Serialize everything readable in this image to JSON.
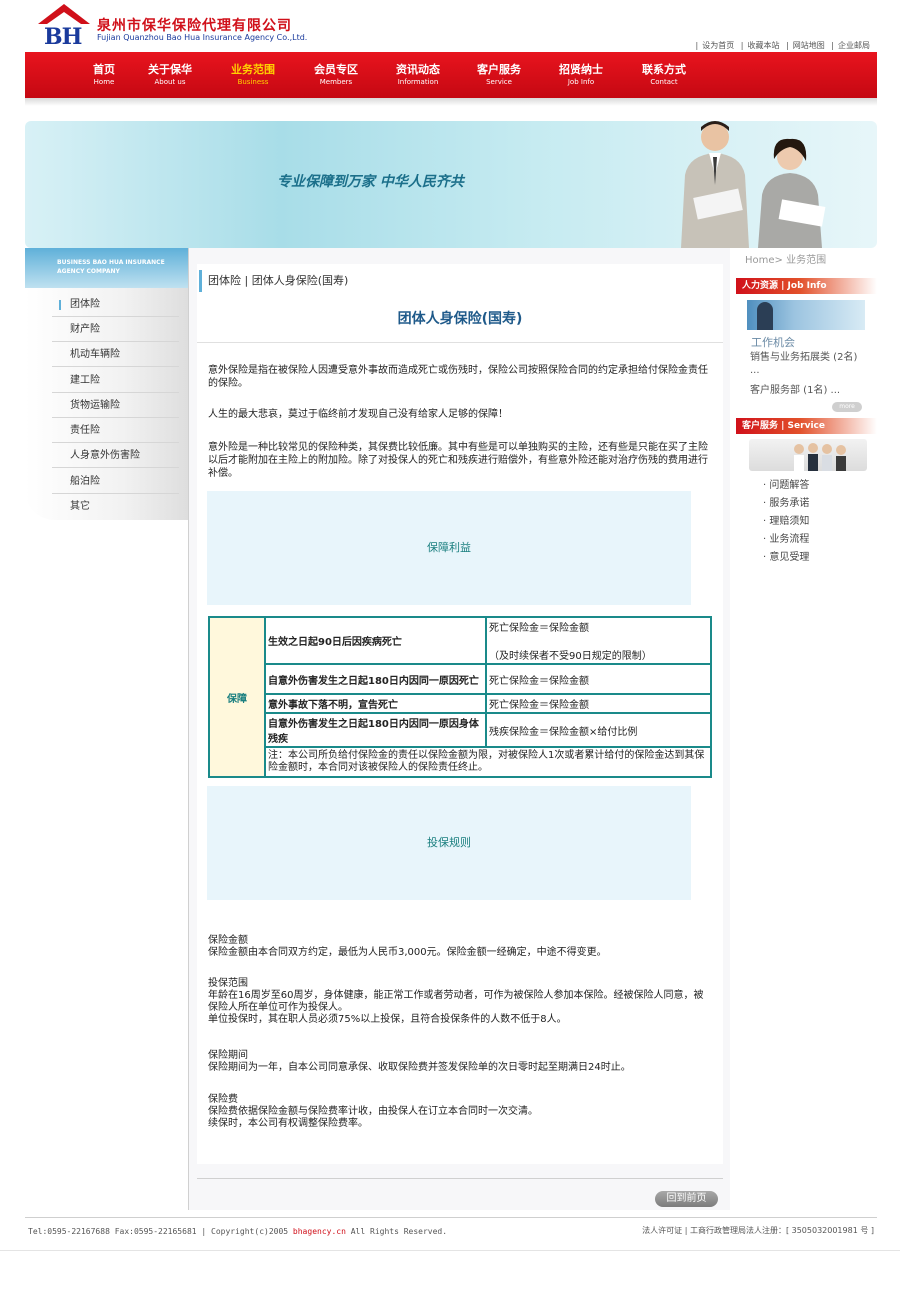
{
  "header": {
    "logo_text": "BH",
    "company_cn": "泉州市保华保险代理有限公司",
    "company_en": "Fujian Quanzhou Bao Hua Insurance Agency Co.,Ltd.",
    "top_links": [
      "设为首页",
      "收藏本站",
      "网站地图",
      "企业邮局"
    ]
  },
  "nav": [
    {
      "cn": "首页",
      "en": "Home"
    },
    {
      "cn": "关于保华",
      "en": "About us"
    },
    {
      "cn": "业务范围",
      "en": "Business"
    },
    {
      "cn": "会员专区",
      "en": "Members"
    },
    {
      "cn": "资讯动态",
      "en": "Information"
    },
    {
      "cn": "客户服务",
      "en": "Service"
    },
    {
      "cn": "招贤纳士",
      "en": "Job Info"
    },
    {
      "cn": "联系方式",
      "en": "Contact"
    }
  ],
  "nav_active_index": 2,
  "banner": {
    "slogan": "专业保障到万家  中华人民齐共"
  },
  "left_sidebar": {
    "header_text": "BUSINESS BAO HUA INSURANCE AGENCY COMPANY",
    "items": [
      "团体险",
      "财产险",
      "机动车辆险",
      "建工险",
      "货物运输险",
      "责任险",
      "人身意外伤害险",
      "船泊险",
      "其它"
    ],
    "active_index": 0
  },
  "main": {
    "breadcrumb": "团体险  |  团体人身保险(国寿)",
    "heading": "团体人身保险(国寿)",
    "intro_paragraphs": [
      "意外保险是指在被保险人因遭受意外事故而造成死亡或伤残时，保险公司按照保险合同的约定承担给付保险金责任的保险。",
      "人生的最大悲哀，莫过于临终前才发现自己没有给家人足够的保障！",
      "意外险是一种比较常见的保险种类，其保费比较低廉。其中有些是可以单独购买的主险，还有些是只能在买了主险以后才能附加在主险上的附加险。除了对投保人的死亡和残疾进行赔偿外，有些意外险还能对治疗伤残的费用进行补偿。"
    ],
    "benefit_section_title": "保障利益",
    "benefit_table": {
      "label": "保障",
      "rows": [
        {
          "condition": "生效之日起90日后因疾病死亡",
          "result_lines": [
            "死亡保险金＝保险金额",
            "（及时续保者不受90日规定的限制）"
          ]
        },
        {
          "condition": "自意外伤害发生之日起180日内因同一原因死亡",
          "result_lines": [
            "死亡保险金＝保险金额"
          ]
        },
        {
          "condition": "意外事故下落不明，宣告死亡",
          "result_lines": [
            "死亡保险金＝保险金额"
          ]
        },
        {
          "condition": "自意外伤害发生之日起180日内因同一原因身体残疾",
          "result_lines": [
            "残疾保险金＝保险金额×给付比例"
          ]
        }
      ],
      "note": "注：本公司所负给付保险金的责任以保险金额为限，对被保险人1次或者累计给付的保险金达到其保险金额时，本合同对该被保险人的保险责任终止。"
    },
    "rules_section_title": "投保规则",
    "rules": [
      {
        "title": "保险金额",
        "lines": [
          "保险金额由本合同双方约定，最低为人民币3,000元。保险金额一经确定，中途不得变更。"
        ]
      },
      {
        "title": "投保范围",
        "lines": [
          "年龄在16周岁至60周岁，身体健康，能正常工作或者劳动者，可作为被保险人参加本保险。经被保险人同意，被保险人所在单位可作为投保人。",
          "单位投保时，其在职人员必须75%以上投保，且符合投保条件的人数不低于8人。"
        ]
      },
      {
        "title": "保险期间",
        "lines": [
          "保险期间为一年，自本公司同意承保、收取保险费并签发保险单的次日零时起至期满日24时止。"
        ]
      },
      {
        "title": "保险费",
        "lines": [
          "保险费依据保险金额与保险费率计收，由投保人在订立本合同时一次交清。",
          "续保时，本公司有权调整保险费率。"
        ]
      }
    ],
    "back_button": "回到前页"
  },
  "right_sidebar": {
    "breadcrumb": "Home> 业务范围",
    "hr_header": "人力资源 | Job Info",
    "hr_title": "工作机会",
    "jobs": [
      "销售与业务拓展类 (2名) ...",
      "客户服务部 (1名) ..."
    ],
    "more": "more",
    "service_header": "客户服务 | Service",
    "service_items": [
      "· 问题解答",
      "· 服务承诺",
      "· 理赔须知",
      "· 业务流程",
      "· 意见受理"
    ]
  },
  "footer": {
    "contact": "Tel:0595-22167688 Fax:0595-22165681 | Copyright(c)2005",
    "domain": "bhagency.cn",
    "rights": "All Rights Reserved.",
    "license": "法人许可证 | 工商行政管理局法人注册：[ 3505032001981 号 ]"
  },
  "colors": {
    "brand_red": "#d0101a",
    "nav_active": "#ffd200",
    "heading_blue": "#1f5a8a",
    "table_border": "#1a8a8a"
  }
}
